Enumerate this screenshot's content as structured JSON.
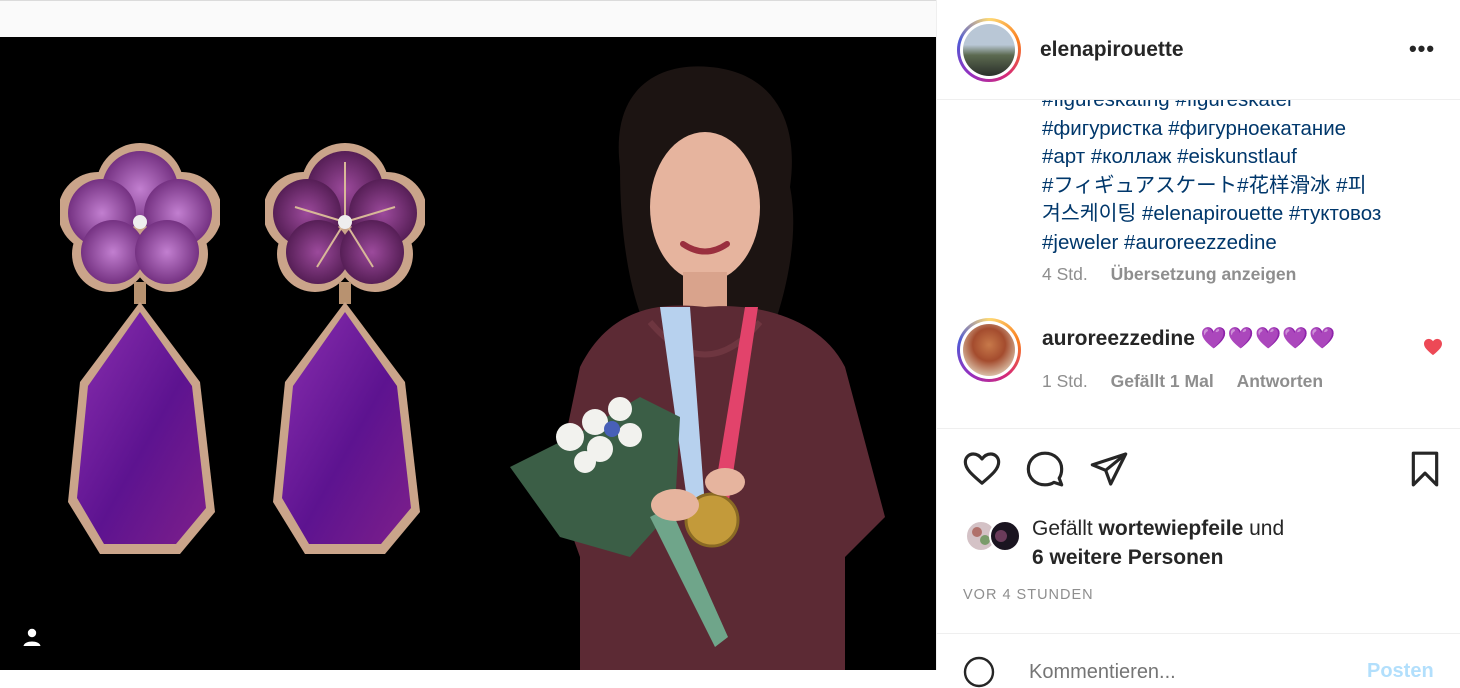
{
  "post": {
    "username": "elenapirouette",
    "more_label": "•••",
    "caption_lines": [
      "#figureskating #figureskater",
      "#фигуристка #фигурноекатание",
      "#арт #коллаж #eiskunstlauf",
      "#フィギュアスケート#花样滑冰 #피",
      "겨스케이팅 #elenapirouette #туктовоз",
      "#jeweler #auroreezzedine"
    ],
    "caption_time": "4 Std.",
    "translate_label": "Übersetzung anzeigen"
  },
  "comment": {
    "username": "auroreezzedine",
    "text": "💜💜💜💜💜",
    "time": "1 Std.",
    "likes": "Gefällt 1 Mal",
    "reply_label": "Antworten"
  },
  "likes": {
    "prefix": "Gefällt",
    "user": "wortewiepfeile",
    "joiner": "und",
    "others": "6 weitere Personen"
  },
  "timestamp": "VOR 4 STUNDEN",
  "comment_input": {
    "placeholder": "Kommentieren...",
    "post_label": "Posten"
  },
  "colors": {
    "hashtag": "#00376b",
    "muted": "#8e8e8e",
    "like_red": "#ed4956",
    "post_disabled": "#b2dffc"
  }
}
